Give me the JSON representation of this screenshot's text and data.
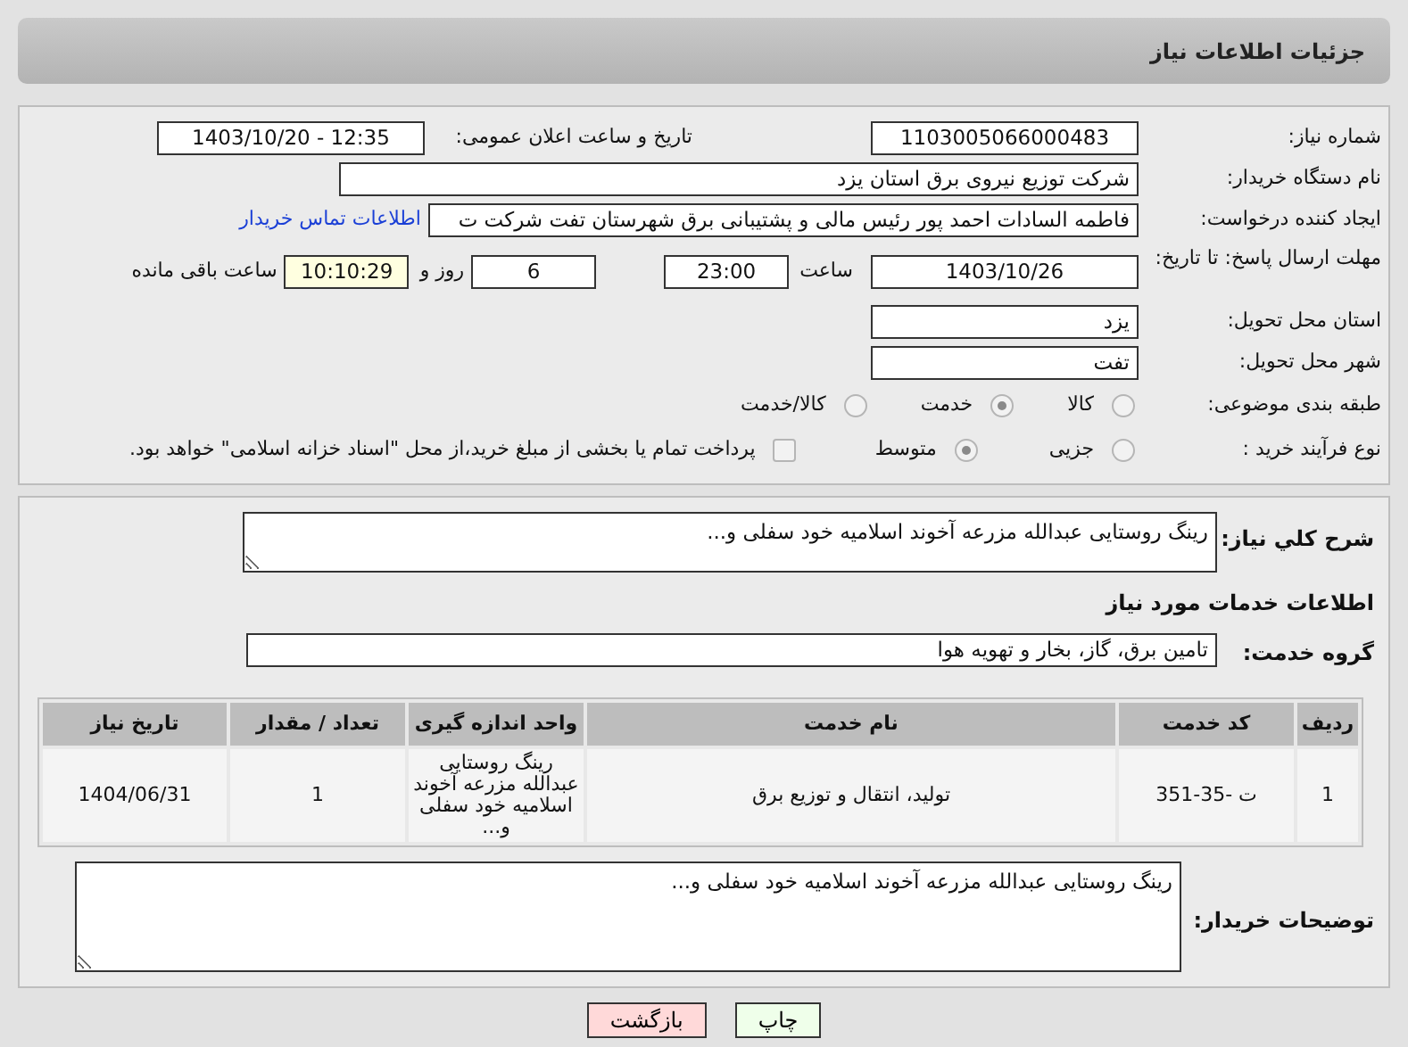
{
  "page_title": "جزئیات اطلاعات نیاز",
  "need_number": {
    "label": "شماره نیاز:",
    "value": "1103005066000483"
  },
  "announce_datetime": {
    "label": "تاریخ و ساعت اعلان عمومی:",
    "value": "1403/10/20 - 12:35"
  },
  "buyer_org": {
    "label": "نام دستگاه خریدار:",
    "value": "شرکت توزیع نیروی برق استان یزد"
  },
  "requester": {
    "label": "ایجاد کننده درخواست:",
    "value": "فاطمه السادات  احمد پور  رئیس مالی و پشتیبانی برق شهرستان تفت شرکت ت",
    "link": "اطلاعات تماس خریدار"
  },
  "deadline": {
    "label": "مهلت ارسال پاسخ: تا تاریخ:",
    "date": "1403/10/26",
    "time_label": "ساعت",
    "time": "23:00",
    "days": "6",
    "days_label": "روز و",
    "remaining": "10:10:29",
    "remaining_label": "ساعت باقی مانده"
  },
  "province": {
    "label": "استان محل تحویل:",
    "value": "یزد"
  },
  "city": {
    "label": "شهر محل تحویل:",
    "value": "تفت"
  },
  "category": {
    "label": "طبقه بندی موضوعی:",
    "options": [
      {
        "label": "کالا",
        "selected": false
      },
      {
        "label": "خدمت",
        "selected": true
      },
      {
        "label": "کالا/خدمت",
        "selected": false
      }
    ]
  },
  "purchase_type": {
    "label": "نوع فرآیند خرید :",
    "options": [
      {
        "label": "جزیی",
        "selected": false
      },
      {
        "label": "متوسط",
        "selected": true
      }
    ],
    "payment": {
      "checked": false,
      "text": "پرداخت تمام یا بخشی از مبلغ خرید،از محل \"اسناد خزانه اسلامی\" خواهد بود."
    }
  },
  "description": {
    "label": "شرح کلي نياز:",
    "value": "رینگ روستایی عبدالله مزرعه آخوند اسلامیه خود سفلی و..."
  },
  "services_heading": "اطلاعات خدمات مورد نیاز",
  "service_group": {
    "label": "گروه خدمت:",
    "value": "تامین برق، گاز، بخار و تهویه هوا"
  },
  "table": {
    "columns": [
      "ردیف",
      "کد خدمت",
      "نام خدمت",
      "واحد اندازه گیری",
      "تعداد / مقدار",
      "تاریخ نیاز"
    ],
    "rows": [
      [
        "1",
        "ت -35-351",
        "تولید، انتقال و توزیع برق",
        "رینگ روستایی عبدالله مزرعه آخوند اسلامیه خود سفلی و...",
        "1",
        "1404/06/31"
      ]
    ]
  },
  "buyer_notes": {
    "label": "توضیحات خریدار:",
    "value": "رینگ روستایی عبدالله مزرعه آخوند اسلامیه خود سفلی و..."
  },
  "buttons": [
    {
      "label": "چاپ",
      "kind": "print"
    },
    {
      "label": "بازگشت",
      "kind": "back"
    }
  ]
}
